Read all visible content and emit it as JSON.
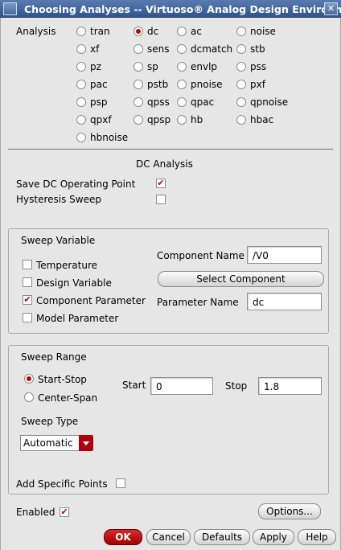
{
  "window": {
    "title": "Choosing Analyses -- Virtuoso® Analog Design Environm",
    "close_glyph": "✕"
  },
  "analysis": {
    "label": "Analysis",
    "options": [
      "tran",
      "dc",
      "ac",
      "noise",
      "xf",
      "sens",
      "dcmatch",
      "stb",
      "pz",
      "sp",
      "envlp",
      "pss",
      "pac",
      "pstb",
      "pnoise",
      "pxf",
      "psp",
      "qpss",
      "qpac",
      "qpnoise",
      "qpxf",
      "qpsp",
      "hb",
      "hbac",
      "hbnoise"
    ],
    "selected": "dc"
  },
  "dc": {
    "section_title": "DC Analysis",
    "save_op_label": "Save DC Operating Point",
    "save_op_checked": true,
    "hysteresis_label": "Hysteresis Sweep",
    "hysteresis_checked": false
  },
  "sweep_variable": {
    "title": "Sweep Variable",
    "temperature_label": "Temperature",
    "design_variable_label": "Design Variable",
    "component_parameter_label": "Component Parameter",
    "model_parameter_label": "Model Parameter",
    "component_name_label": "Component Name",
    "component_name_value": "/V0",
    "select_component_label": "Select Component",
    "parameter_name_label": "Parameter Name",
    "parameter_name_value": "dc"
  },
  "sweep_range": {
    "title": "Sweep Range",
    "start_stop_label": "Start-Stop",
    "center_span_label": "Center-Span",
    "start_label": "Start",
    "start_value": "0",
    "stop_label": "Stop",
    "stop_value": "1.8",
    "sweep_type_label": "Sweep Type",
    "sweep_type_value": "Automatic",
    "add_points_label": "Add Specific Points"
  },
  "footer": {
    "enabled_label": "Enabled",
    "options_label": "Options...",
    "ok_label": "OK",
    "cancel_label": "Cancel",
    "defaults_label": "Defaults",
    "apply_label": "Apply",
    "help_label": "Help"
  },
  "checkmark": "✔"
}
